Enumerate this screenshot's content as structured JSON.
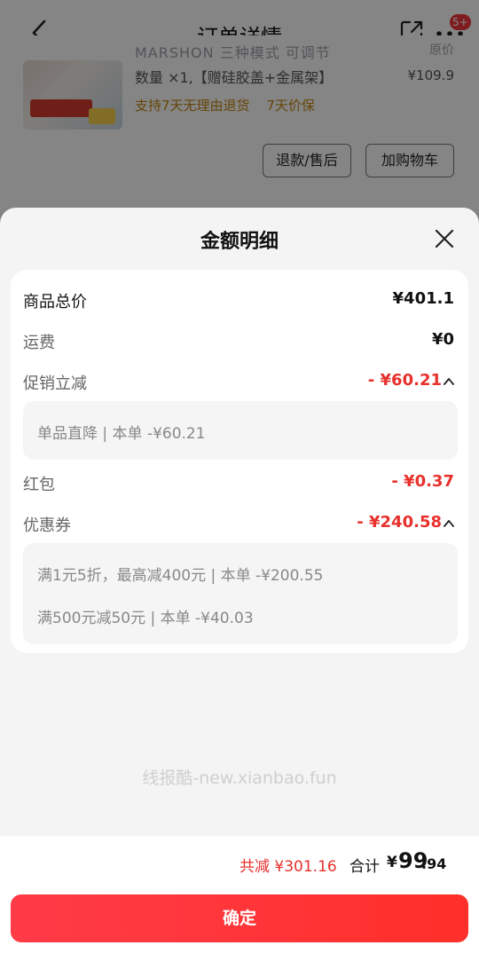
{
  "header": {
    "title": "订单详情",
    "badge": "5+",
    "icons": [
      "back-arrow-icon",
      "share-icon",
      "more-icon"
    ]
  },
  "product": {
    "name_partial": "MARSHON 三种模式 可调节",
    "right_partial": "原价",
    "spec": "数量 ×1,【赠硅胶盖+金属架】",
    "price": "¥109.9",
    "tag1": "支持7天无理由退货",
    "tag2": "7天价保",
    "refund_button": "退款/售后",
    "cart_button": "加购物车"
  },
  "sheet": {
    "title": "金额明细",
    "rows": {
      "total_label": "商品总价",
      "total_value": "¥401.1",
      "shipping_label": "运费",
      "shipping_value": "¥0",
      "promo_label": "促销立减",
      "promo_value": "- ¥60.21",
      "promo_detail": "单品直降 | 本单 -¥60.21",
      "redpacket_label": "红包",
      "redpacket_value": "- ¥0.37",
      "coupon_label": "优惠券",
      "coupon_value": "- ¥240.58",
      "coupon_detail_1": "满1元5折，最高减400元 | 本单 -¥200.55",
      "coupon_detail_2": "满500元减50元 | 本单 -¥40.03"
    },
    "watermark": "线报酷-new.xianbao.fun"
  },
  "footer": {
    "saved": "共减 ¥301.16",
    "total_label": "合计",
    "total_currency": "¥",
    "total_int": "99",
    "total_dec": ".94",
    "confirm": "确定"
  },
  "colors": {
    "accent_red": "#e8302c",
    "button_gradient_start": "#ff3b48",
    "button_gradient_end": "#ff2f2a",
    "tag_gold": "#c1860e"
  }
}
